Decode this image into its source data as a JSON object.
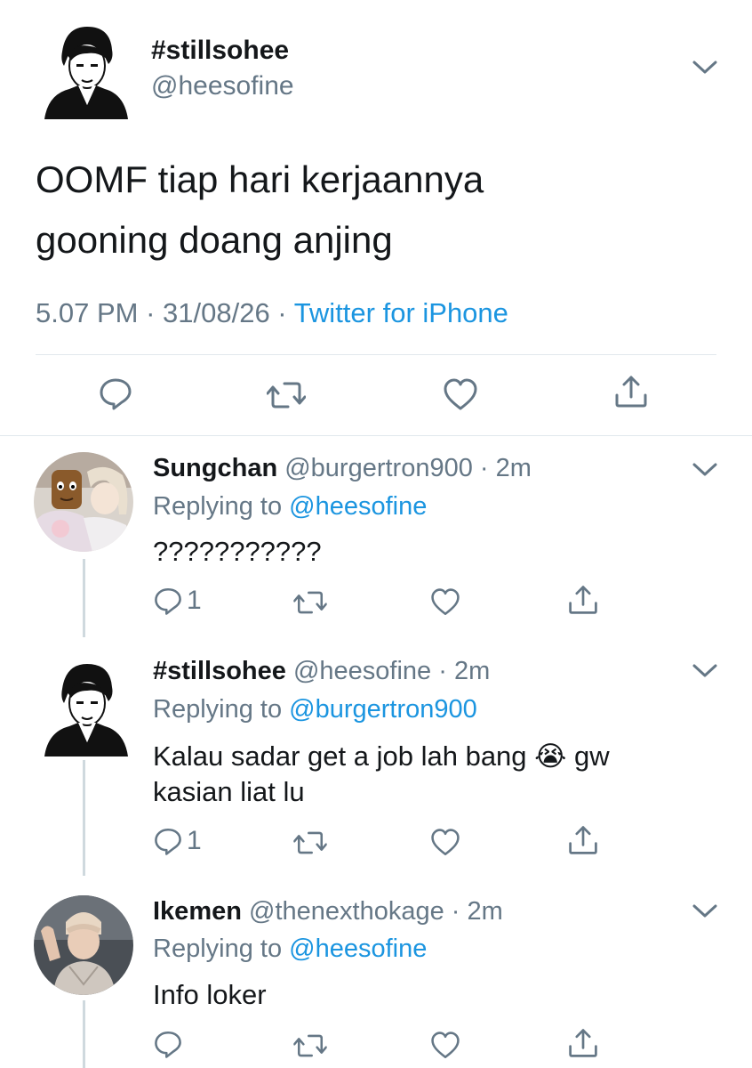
{
  "main_tweet": {
    "display_name": "#stillsohee",
    "handle": "@heesofine",
    "text_line1": "OOMF tiap hari kerjaannya",
    "text_line2": "gooning doang anjing",
    "time": "5.07 PM",
    "date": "31/08/26",
    "source": "Twitter for iPhone",
    "sep": " · "
  },
  "replies": [
    {
      "display_name": "Sungchan",
      "handle": "@burgertron900",
      "time": "2m",
      "replying_prefix": "Replying to ",
      "replying_to": "@heesofine",
      "text": "???????????",
      "reply_count": "1",
      "sep": " · "
    },
    {
      "display_name": "#stillsohee",
      "handle": "@heesofine",
      "time": "2m",
      "replying_prefix": "Replying to ",
      "replying_to": "@burgertron900",
      "text_part1": "Kalau sadar get a job lah bang ",
      "emoji": "😭",
      "text_part2": " gw",
      "text_line2": "kasian liat lu",
      "reply_count": "1",
      "sep": " · "
    },
    {
      "display_name": "Ikemen",
      "handle": "@thenexthokage",
      "time": "2m",
      "replying_prefix": "Replying to ",
      "replying_to": "@heesofine",
      "text": "Info loker",
      "reply_count": "",
      "sep": " · "
    }
  ],
  "icons": {
    "reply": "reply-icon",
    "retweet": "retweet-icon",
    "like": "heart-icon",
    "share": "share-icon",
    "more": "chevron-down-icon"
  },
  "colors": {
    "link": "#1b95e0",
    "muted": "#657786",
    "divider": "#e1e8ed"
  }
}
